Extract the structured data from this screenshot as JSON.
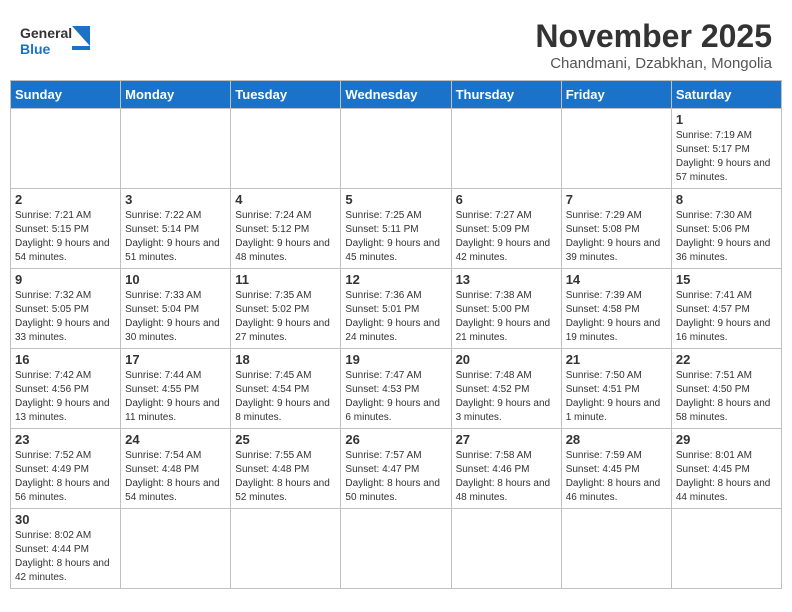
{
  "header": {
    "logo_general": "General",
    "logo_blue": "Blue",
    "title": "November 2025",
    "subtitle": "Chandmani, Dzabkhan, Mongolia"
  },
  "weekdays": [
    "Sunday",
    "Monday",
    "Tuesday",
    "Wednesday",
    "Thursday",
    "Friday",
    "Saturday"
  ],
  "weeks": [
    [
      {
        "day": null
      },
      {
        "day": null
      },
      {
        "day": null
      },
      {
        "day": null
      },
      {
        "day": null
      },
      {
        "day": null
      },
      {
        "day": "1",
        "sunrise": "7:19 AM",
        "sunset": "5:17 PM",
        "daylight": "9 hours and 57 minutes."
      }
    ],
    [
      {
        "day": "2",
        "sunrise": "7:21 AM",
        "sunset": "5:15 PM",
        "daylight": "9 hours and 54 minutes."
      },
      {
        "day": "3",
        "sunrise": "7:22 AM",
        "sunset": "5:14 PM",
        "daylight": "9 hours and 51 minutes."
      },
      {
        "day": "4",
        "sunrise": "7:24 AM",
        "sunset": "5:12 PM",
        "daylight": "9 hours and 48 minutes."
      },
      {
        "day": "5",
        "sunrise": "7:25 AM",
        "sunset": "5:11 PM",
        "daylight": "9 hours and 45 minutes."
      },
      {
        "day": "6",
        "sunrise": "7:27 AM",
        "sunset": "5:09 PM",
        "daylight": "9 hours and 42 minutes."
      },
      {
        "day": "7",
        "sunrise": "7:29 AM",
        "sunset": "5:08 PM",
        "daylight": "9 hours and 39 minutes."
      },
      {
        "day": "8",
        "sunrise": "7:30 AM",
        "sunset": "5:06 PM",
        "daylight": "9 hours and 36 minutes."
      }
    ],
    [
      {
        "day": "9",
        "sunrise": "7:32 AM",
        "sunset": "5:05 PM",
        "daylight": "9 hours and 33 minutes."
      },
      {
        "day": "10",
        "sunrise": "7:33 AM",
        "sunset": "5:04 PM",
        "daylight": "9 hours and 30 minutes."
      },
      {
        "day": "11",
        "sunrise": "7:35 AM",
        "sunset": "5:02 PM",
        "daylight": "9 hours and 27 minutes."
      },
      {
        "day": "12",
        "sunrise": "7:36 AM",
        "sunset": "5:01 PM",
        "daylight": "9 hours and 24 minutes."
      },
      {
        "day": "13",
        "sunrise": "7:38 AM",
        "sunset": "5:00 PM",
        "daylight": "9 hours and 21 minutes."
      },
      {
        "day": "14",
        "sunrise": "7:39 AM",
        "sunset": "4:58 PM",
        "daylight": "9 hours and 19 minutes."
      },
      {
        "day": "15",
        "sunrise": "7:41 AM",
        "sunset": "4:57 PM",
        "daylight": "9 hours and 16 minutes."
      }
    ],
    [
      {
        "day": "16",
        "sunrise": "7:42 AM",
        "sunset": "4:56 PM",
        "daylight": "9 hours and 13 minutes."
      },
      {
        "day": "17",
        "sunrise": "7:44 AM",
        "sunset": "4:55 PM",
        "daylight": "9 hours and 11 minutes."
      },
      {
        "day": "18",
        "sunrise": "7:45 AM",
        "sunset": "4:54 PM",
        "daylight": "9 hours and 8 minutes."
      },
      {
        "day": "19",
        "sunrise": "7:47 AM",
        "sunset": "4:53 PM",
        "daylight": "9 hours and 6 minutes."
      },
      {
        "day": "20",
        "sunrise": "7:48 AM",
        "sunset": "4:52 PM",
        "daylight": "9 hours and 3 minutes."
      },
      {
        "day": "21",
        "sunrise": "7:50 AM",
        "sunset": "4:51 PM",
        "daylight": "9 hours and 1 minute."
      },
      {
        "day": "22",
        "sunrise": "7:51 AM",
        "sunset": "4:50 PM",
        "daylight": "8 hours and 58 minutes."
      }
    ],
    [
      {
        "day": "23",
        "sunrise": "7:52 AM",
        "sunset": "4:49 PM",
        "daylight": "8 hours and 56 minutes."
      },
      {
        "day": "24",
        "sunrise": "7:54 AM",
        "sunset": "4:48 PM",
        "daylight": "8 hours and 54 minutes."
      },
      {
        "day": "25",
        "sunrise": "7:55 AM",
        "sunset": "4:48 PM",
        "daylight": "8 hours and 52 minutes."
      },
      {
        "day": "26",
        "sunrise": "7:57 AM",
        "sunset": "4:47 PM",
        "daylight": "8 hours and 50 minutes."
      },
      {
        "day": "27",
        "sunrise": "7:58 AM",
        "sunset": "4:46 PM",
        "daylight": "8 hours and 48 minutes."
      },
      {
        "day": "28",
        "sunrise": "7:59 AM",
        "sunset": "4:45 PM",
        "daylight": "8 hours and 46 minutes."
      },
      {
        "day": "29",
        "sunrise": "8:01 AM",
        "sunset": "4:45 PM",
        "daylight": "8 hours and 44 minutes."
      }
    ],
    [
      {
        "day": "30",
        "sunrise": "8:02 AM",
        "sunset": "4:44 PM",
        "daylight": "8 hours and 42 minutes."
      },
      {
        "day": null
      },
      {
        "day": null
      },
      {
        "day": null
      },
      {
        "day": null
      },
      {
        "day": null
      },
      {
        "day": null
      }
    ]
  ]
}
